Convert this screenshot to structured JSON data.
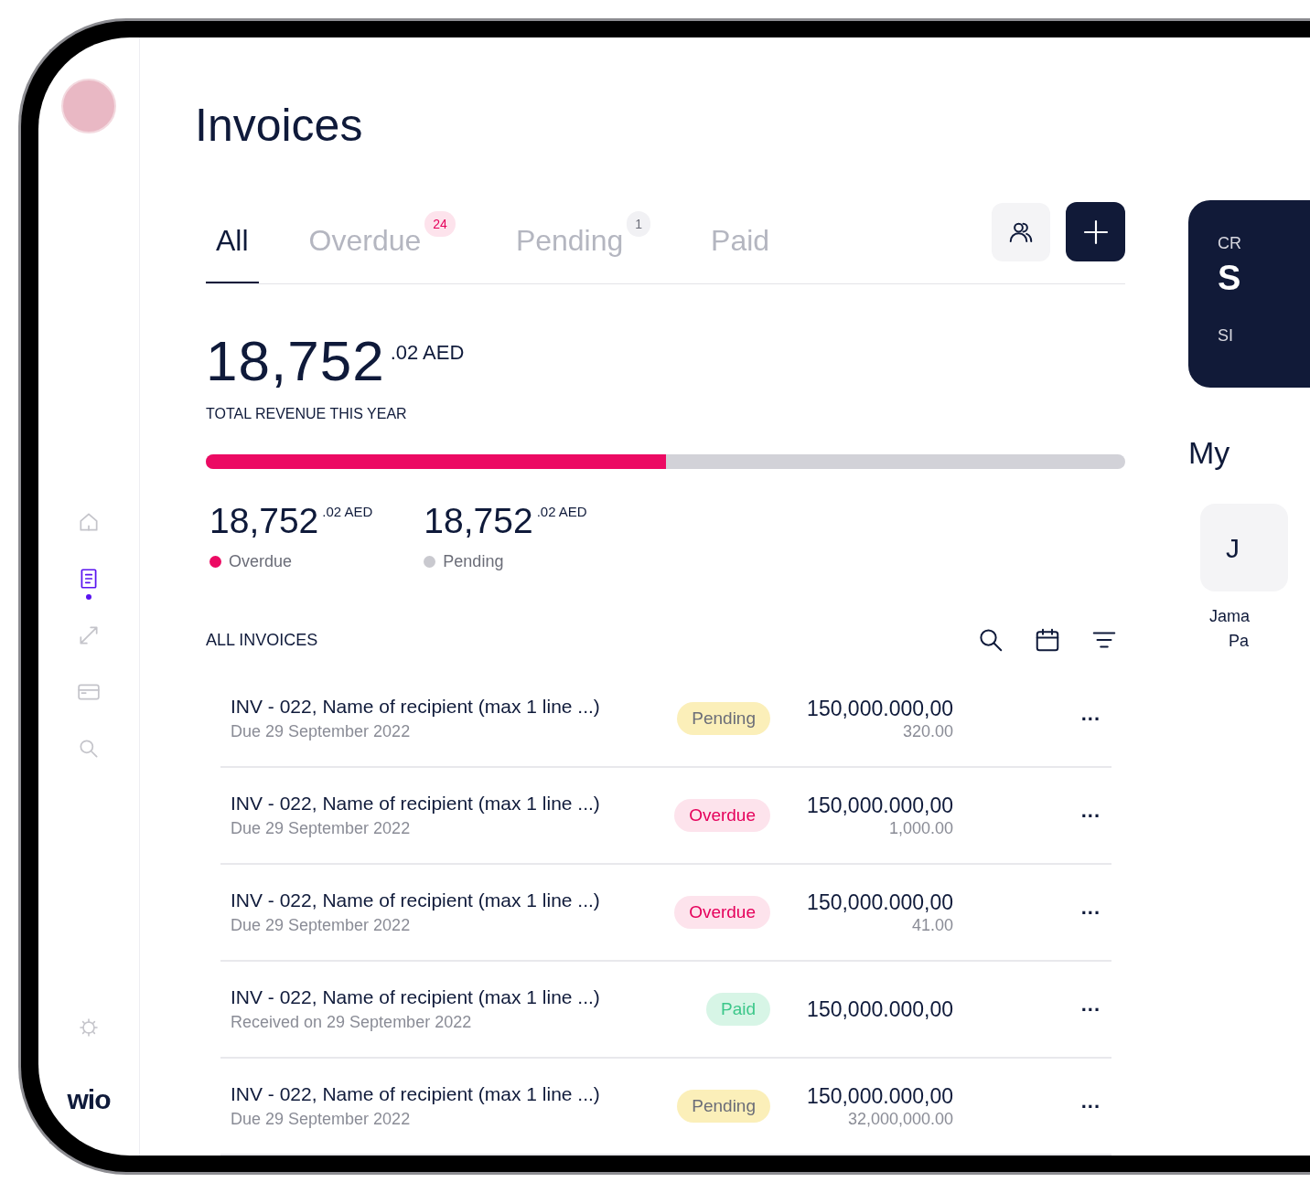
{
  "sidebar": {
    "nav": [
      {
        "kind": "home",
        "selected": false
      },
      {
        "kind": "document",
        "selected": true
      },
      {
        "kind": "arrows",
        "selected": false
      },
      {
        "kind": "card",
        "selected": false
      },
      {
        "kind": "search",
        "selected": false
      }
    ],
    "logo": "wio"
  },
  "title": "Invoices",
  "tabs": [
    {
      "label": "All",
      "selected": true
    },
    {
      "label": "Overdue",
      "selected": false,
      "badge": "24",
      "kind": "alert"
    },
    {
      "label": "Pending",
      "selected": false,
      "badge": "1",
      "kind": "neutral"
    },
    {
      "label": "Paid",
      "selected": false
    }
  ],
  "total": {
    "amount": "18,752",
    "fraction": ".02 AED",
    "label": "TOTAL REVENUE THIS YEAR",
    "level": 0.5
  },
  "breakdown": [
    {
      "amount": "18,752",
      "fraction": ".02 AED",
      "label": "Overdue",
      "color": "#ec0a63"
    },
    {
      "amount": "18,752",
      "fraction": ".02 AED",
      "label": "Pending",
      "color": "#c9c9cf"
    }
  ],
  "list_title": "ALL INVOICES",
  "invoices": [
    {
      "title": "INV - 022, Name of recipient (max 1 line ...)",
      "date": "Due 29 September 2022",
      "status": "Pending",
      "kind": "pending",
      "amount": "150,000.000,00",
      "sub_amount": "320.00",
      "more": "..."
    },
    {
      "title": "INV - 022, Name of recipient (max 1 line ...)",
      "date": "Due 29 September 2022",
      "status": "Overdue",
      "kind": "overdue",
      "amount": "150,000.000,00",
      "sub_amount": "1,000.00",
      "more": "..."
    },
    {
      "title": "INV - 022, Name of recipient (max 1 line ...)",
      "date": "Due 29 September 2022",
      "status": "Overdue",
      "kind": "overdue",
      "amount": "150,000.000,00",
      "sub_amount": "41.00",
      "more": "..."
    },
    {
      "title": "INV - 022, Name of recipient (max 1 line ...)",
      "date": "Received on 29 September 2022",
      "status": "Paid",
      "kind": "paid",
      "amount": "150,000.000,00",
      "more": "..."
    },
    {
      "title": "INV - 022, Name of recipient (max 1 line ...)",
      "date": "Due 29 September 2022",
      "status": "Pending",
      "kind": "pending",
      "amount": "150,000.000,00",
      "sub_amount": "32,000,000.00",
      "more": "..."
    }
  ],
  "promo_card": {
    "line_1": "CR",
    "line_2": "S",
    "line_3": "SI"
  },
  "contacts": {
    "title": "My",
    "items": [
      {
        "initial": "J",
        "name_line_1": "Jama",
        "name_line_2": "Pa"
      }
    ]
  }
}
